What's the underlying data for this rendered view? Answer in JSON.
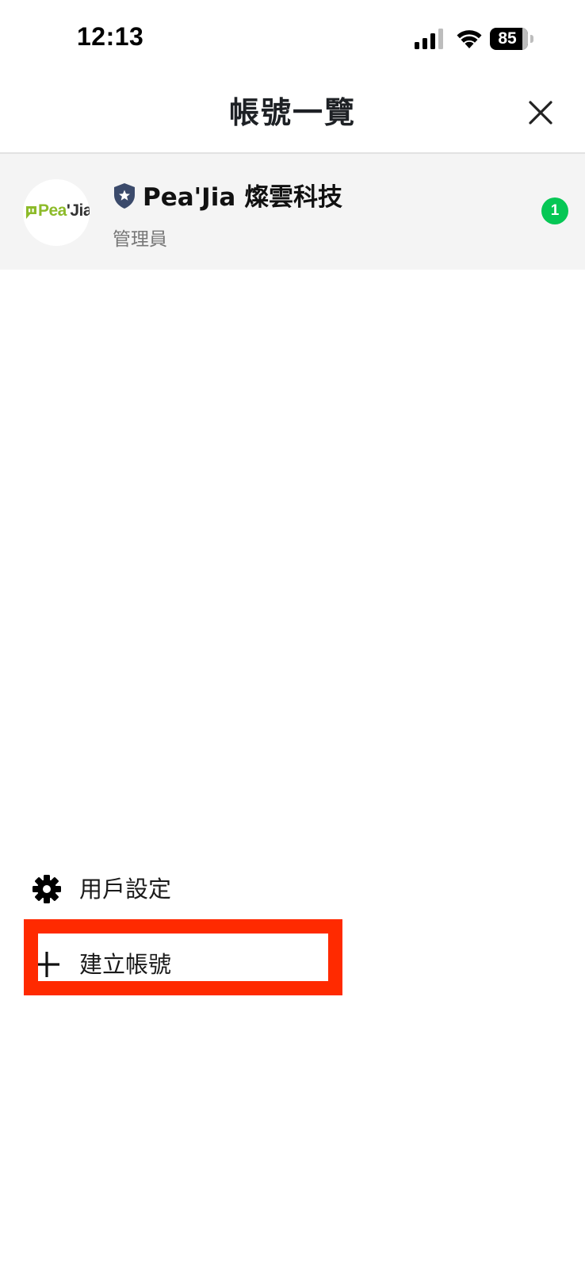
{
  "status_bar": {
    "time": "12:13",
    "battery_level": "85",
    "signal_icon": "cellular-signal-icon",
    "wifi_icon": "wifi-icon",
    "battery_icon": "battery-icon"
  },
  "header": {
    "title": "帳號一覽",
    "close_icon": "close-icon"
  },
  "account": {
    "logo_text_green": "Pea",
    "logo_text_dark": "'Jia",
    "role_icon": "shield-star-icon",
    "name": "Pea'Jia 燦雲科技",
    "role": "管理員",
    "badge_count": "1"
  },
  "menu": {
    "settings_label": "用戶設定",
    "settings_icon": "gear-icon",
    "create_label": "建立帳號",
    "create_icon": "plus-icon"
  },
  "colors": {
    "badge": "#06c755",
    "highlight": "#ff2a00",
    "row_background": "#f4f4f4",
    "shield": "#3b4a6b",
    "logo_green": "#8dbb2a"
  }
}
